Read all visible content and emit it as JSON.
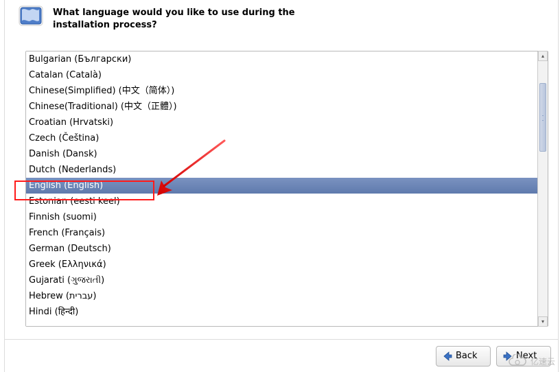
{
  "prompt": "What language would you like to use during the installation process?",
  "languages": [
    "Bulgarian (Български)",
    "Catalan (Català)",
    "Chinese(Simplified) (中文（简体）)",
    "Chinese(Traditional) (中文（正體）)",
    "Croatian (Hrvatski)",
    "Czech (Čeština)",
    "Danish (Dansk)",
    "Dutch (Nederlands)",
    "English (English)",
    "Estonian (eesti keel)",
    "Finnish (suomi)",
    "French (Français)",
    "German (Deutsch)",
    "Greek (Ελληνικά)",
    "Gujarati (ગુજરાતી)",
    "Hebrew (עברית)",
    "Hindi (हिन्दी)"
  ],
  "selected_index": 8,
  "buttons": {
    "back": "Back",
    "next": "Next"
  },
  "watermark": "亿速云"
}
